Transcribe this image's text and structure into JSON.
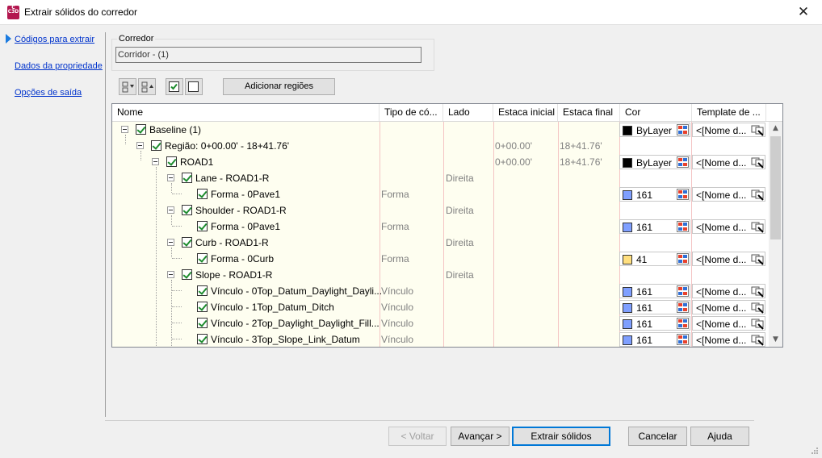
{
  "window": {
    "title": "Extrair sólidos do corredor",
    "app_icon_text": "C",
    "app_icon_sub": "C3D",
    "close_glyph": "✕"
  },
  "nav": {
    "items": [
      {
        "label": "Códigos para extrair"
      },
      {
        "label": "Dados da propriedade"
      },
      {
        "label": "Opções de saída"
      }
    ]
  },
  "corridor": {
    "label": "Corredor",
    "value": "Corridor - (1)"
  },
  "toolbar": {
    "add_regions_label": "Adicionar regiões"
  },
  "grid": {
    "columns": [
      "Nome",
      "Tipo de có...",
      "Lado",
      "Estaca inicial",
      "Estaca final",
      "Cor",
      "Template de ..."
    ],
    "rows": [
      {
        "name": "Baseline (1)",
        "type": "",
        "side": "",
        "start": "",
        "end": "",
        "color_name": "ByLayer",
        "color_hex": "#000000",
        "template": "<[Nome d..."
      },
      {
        "name": "Região: 0+00.00' - 18+41.76'",
        "type": "",
        "side": "",
        "start": "0+00.00'",
        "end": "18+41.76'",
        "color_name": "",
        "color_hex": "",
        "template": ""
      },
      {
        "name": "ROAD1",
        "type": "",
        "side": "",
        "start": "0+00.00'",
        "end": "18+41.76'",
        "color_name": "ByLayer",
        "color_hex": "#000000",
        "template": "<[Nome d..."
      },
      {
        "name": "Lane - ROAD1-R",
        "type": "",
        "side": "Direita",
        "start": "",
        "end": "",
        "color_name": "",
        "color_hex": "",
        "template": ""
      },
      {
        "name": "Forma - 0Pave1",
        "type": "Forma",
        "side": "",
        "start": "",
        "end": "",
        "color_name": "161",
        "color_hex": "#7f9fff",
        "template": "<[Nome d..."
      },
      {
        "name": "Shoulder - ROAD1-R",
        "type": "",
        "side": "Direita",
        "start": "",
        "end": "",
        "color_name": "",
        "color_hex": "",
        "template": ""
      },
      {
        "name": "Forma - 0Pave1",
        "type": "Forma",
        "side": "",
        "start": "",
        "end": "",
        "color_name": "161",
        "color_hex": "#7f9fff",
        "template": "<[Nome d..."
      },
      {
        "name": "Curb - ROAD1-R",
        "type": "",
        "side": "Direita",
        "start": "",
        "end": "",
        "color_name": "",
        "color_hex": "",
        "template": ""
      },
      {
        "name": "Forma - 0Curb",
        "type": "Forma",
        "side": "",
        "start": "",
        "end": "",
        "color_name": "41",
        "color_hex": "#ffdf7f",
        "template": "<[Nome d..."
      },
      {
        "name": "Slope - ROAD1-R",
        "type": "",
        "side": "Direita",
        "start": "",
        "end": "",
        "color_name": "",
        "color_hex": "",
        "template": ""
      },
      {
        "name": "Vínculo - 0Top_Datum_Daylight_Dayli...",
        "type": "Vínculo",
        "side": "",
        "start": "",
        "end": "",
        "color_name": "161",
        "color_hex": "#7f9fff",
        "template": "<[Nome d..."
      },
      {
        "name": "Vínculo - 1Top_Datum_Ditch",
        "type": "Vínculo",
        "side": "",
        "start": "",
        "end": "",
        "color_name": "161",
        "color_hex": "#7f9fff",
        "template": "<[Nome d..."
      },
      {
        "name": "Vínculo - 2Top_Daylight_Daylight_Fill...",
        "type": "Vínculo",
        "side": "",
        "start": "",
        "end": "",
        "color_name": "161",
        "color_hex": "#7f9fff",
        "template": "<[Nome d..."
      },
      {
        "name": "Vínculo - 3Top_Slope_Link_Datum",
        "type": "Vínculo",
        "side": "",
        "start": "",
        "end": "",
        "color_name": "161",
        "color_hex": "#7f9fff",
        "template": "<[Nome d..."
      }
    ]
  },
  "footer": {
    "back_label": "< Voltar",
    "next_label": "Avançar >",
    "extract_label": "Extrair sólidos",
    "cancel_label": "Cancelar",
    "help_label": "Ajuda"
  }
}
